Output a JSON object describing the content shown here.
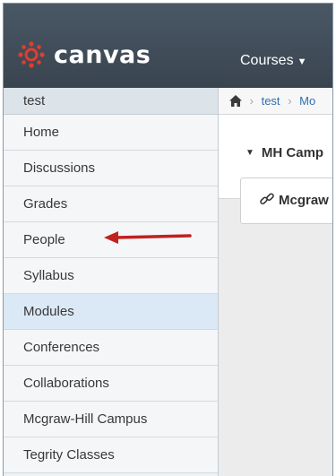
{
  "header": {
    "brand": "canvas",
    "courses_label": "Courses",
    "brand_color": "#e03e2d"
  },
  "sidebar": {
    "title": "test",
    "items": [
      {
        "label": "Home"
      },
      {
        "label": "Discussions"
      },
      {
        "label": "Grades"
      },
      {
        "label": "People"
      },
      {
        "label": "Syllabus"
      },
      {
        "label": "Modules",
        "active": true
      },
      {
        "label": "Conferences"
      },
      {
        "label": "Collaborations"
      },
      {
        "label": "Mcgraw-Hill Campus"
      },
      {
        "label": "Tegrity Classes"
      }
    ]
  },
  "breadcrumb": {
    "items": [
      "test",
      "Mo"
    ]
  },
  "module": {
    "header": "MH Camp",
    "item": "Mcgraw"
  },
  "annotation": {
    "arrow_color": "#c0211f"
  }
}
